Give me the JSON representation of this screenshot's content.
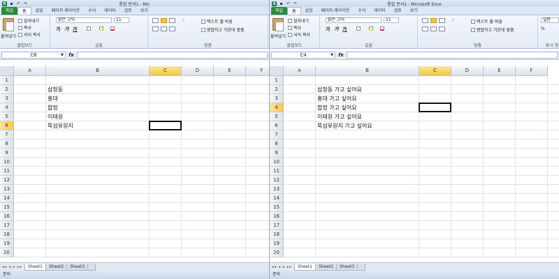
{
  "panes": [
    {
      "title": "통합 문서1 - Mic",
      "tabs": [
        "파일",
        "홈",
        "삽입",
        "페이지 레이아웃",
        "수식",
        "데이터",
        "검토",
        "보기"
      ],
      "ribbon": {
        "paste": "붙여넣기",
        "cut": "잘라내기",
        "copy": "복사",
        "format_painter": "서식 복사",
        "font_name": "맑은 고딕",
        "font_size": "11",
        "wrap_text": "텍스트 줄 바꿈",
        "merge_center": "병합하고 가운데 맞춤",
        "group_clipboard": "클립보드",
        "group_font": "글꼴",
        "group_align": "맞춤"
      },
      "name_box": "C6",
      "columns": [
        "A",
        "B",
        "C",
        "D",
        "E",
        "F"
      ],
      "selected_column": "C",
      "rows": [
        "1",
        "2",
        "3",
        "4",
        "5",
        "6",
        "7",
        "8",
        "9",
        "10",
        "11",
        "12",
        "13",
        "14",
        "15",
        "16",
        "17",
        "18",
        "19",
        "20"
      ],
      "selected_row": "6",
      "cells_b": [
        "삼청동",
        "홍대",
        "합정",
        "이태원",
        "뚝섬유원지"
      ],
      "sheets": [
        "Sheet1",
        "Sheet2",
        "Sheet3"
      ],
      "status": "준비"
    },
    {
      "title": "통합 문서1 - Microsoft Exce",
      "tabs": [
        "파일",
        "홈",
        "삽입",
        "페이지 레이아웃",
        "수식",
        "데이터",
        "검토",
        "보기"
      ],
      "ribbon": {
        "paste": "붙여넣기",
        "cut": "잘라내기",
        "copy": "복사",
        "format_painter": "서식 복사",
        "font_name": "맑은 고딕",
        "font_size": "11",
        "wrap_text": "텍스트 줄 바꿈",
        "merge_center": "병합하고 가운데 맞춤",
        "number_format": "일반",
        "group_clipboard": "클립보드",
        "group_font": "글꼴",
        "group_align": "맞춤",
        "group_number": "표시 형"
      },
      "name_box": "C4",
      "columns": [
        "A",
        "B",
        "C",
        "D",
        "E",
        "F"
      ],
      "selected_column": "C",
      "rows": [
        "1",
        "2",
        "3",
        "4",
        "5",
        "6",
        "7",
        "8",
        "9",
        "10",
        "11",
        "12",
        "13",
        "14",
        "15",
        "16",
        "17",
        "18",
        "19",
        "20"
      ],
      "selected_row": "4",
      "cells_b": [
        "삼청동 가고 싶어요",
        "홍대 가고 싶어요",
        "합정 가고 싶어요",
        "이태원 가고 싶어요",
        "뚝섬유원지 가고 싶어요"
      ],
      "sheets": [
        "Sheet1",
        "Sheet2",
        "Sheet3"
      ],
      "status": "준비"
    }
  ]
}
